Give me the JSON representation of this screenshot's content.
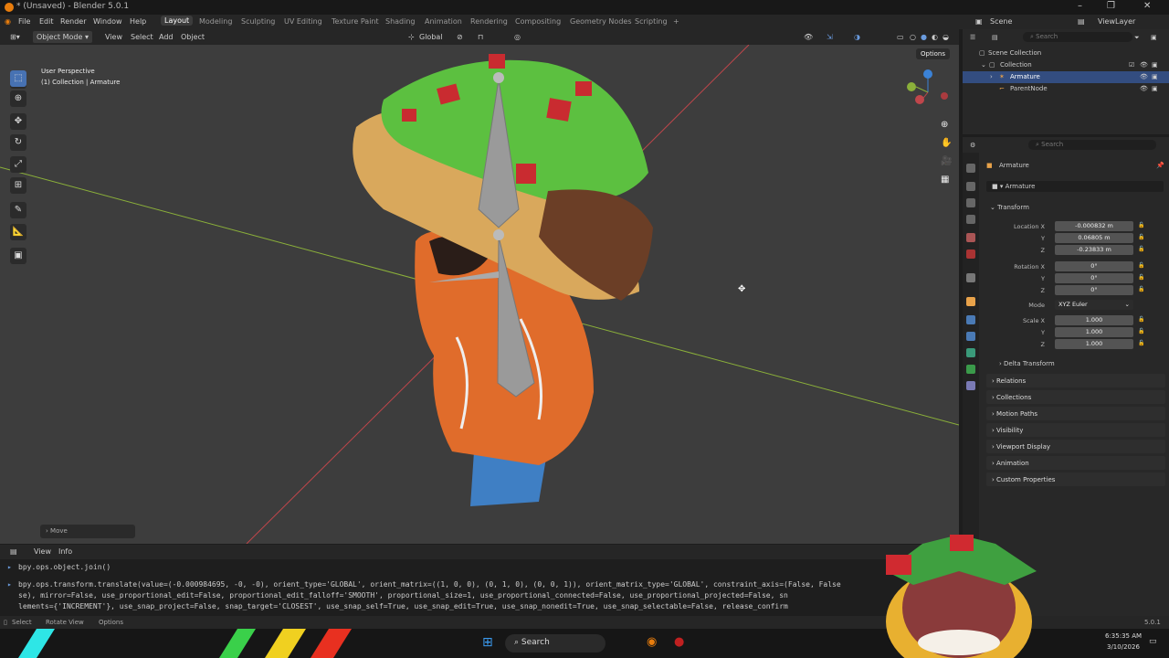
{
  "window": {
    "title": "* (Unsaved) - Blender 5.0.1",
    "minimize": "–",
    "maximize": "❐",
    "close": "✕"
  },
  "menu": {
    "items": [
      "File",
      "Edit",
      "Render",
      "Window",
      "Help"
    ],
    "workspaces": [
      "Layout",
      "Modeling",
      "Sculpting",
      "UV Editing",
      "Texture Paint",
      "Shading",
      "Animation",
      "Rendering",
      "Compositing",
      "Geometry Nodes",
      "Scripting"
    ],
    "add_workspace": "+",
    "scene": "Scene",
    "view_layer": "ViewLayer"
  },
  "viewport_header": {
    "mode": "Object Mode",
    "view": "View",
    "select": "Select",
    "add": "Add",
    "object": "Object",
    "orientation": "Global",
    "options": "Options"
  },
  "viewport": {
    "perspective": "User Perspective",
    "collection_path": "(1) Collection | Armature",
    "operator_panel": "Move"
  },
  "console": {
    "header_view": "View",
    "header_info": "Info",
    "lines": [
      "bpy.ops.object.join()",
      "bpy.ops.transform.translate(value=(-0.000984695, -0, -0), orient_type='GLOBAL', orient_matrix=((1, 0, 0), (0, 1, 0), (0, 0, 1)), orient_matrix_type='GLOBAL', constraint_axis=(False, False",
      "se), mirror=False, use_proportional_edit=False, proportional_edit_falloff='SMOOTH', proportional_size=1, use_proportional_connected=False, use_proportional_projected=False, sn",
      "lements={'INCREMENT'}, use_snap_project=False, snap_target='CLOSEST', use_snap_self=True, use_snap_edit=True, use_snap_nonedit=True, use_snap_selectable=False, release_confirm"
    ]
  },
  "status": {
    "select": "Select",
    "rotate": "Rotate View",
    "options": "Options",
    "version": "5.0.1"
  },
  "outliner": {
    "search_placeholder": "Search",
    "rows": [
      "Scene Collection",
      "Collection",
      "Armature",
      "ParentNode"
    ]
  },
  "properties": {
    "search_placeholder": "Search",
    "object_name": "Armature",
    "data_name": "Armature",
    "transform_label": "Transform",
    "location": {
      "label": "Location X",
      "x": "-0.000832 m",
      "y": "0.06805 m",
      "z": "-0.23833 m"
    },
    "rotation": {
      "label": "Rotation X",
      "x": "0°",
      "y": "0°",
      "z": "0°"
    },
    "mode": {
      "label": "Mode",
      "value": "XYZ Euler"
    },
    "scale": {
      "label": "Scale X",
      "x": "1.000",
      "y": "1.000",
      "z": "1.000"
    },
    "axis_y": "Y",
    "axis_z": "Z",
    "delta": "Delta Transform",
    "panels": [
      "Relations",
      "Collections",
      "Motion Paths",
      "Visibility",
      "Viewport Display",
      "Animation",
      "Custom Properties"
    ]
  },
  "taskbar": {
    "search": "Search",
    "time": "6:35:35 AM",
    "date": "3/10/2026"
  },
  "colors": {
    "accent": "#4772b3",
    "blender_orange": "#e87d0d",
    "x_axis": "#c0464b",
    "y_axis": "#8bb03a"
  }
}
